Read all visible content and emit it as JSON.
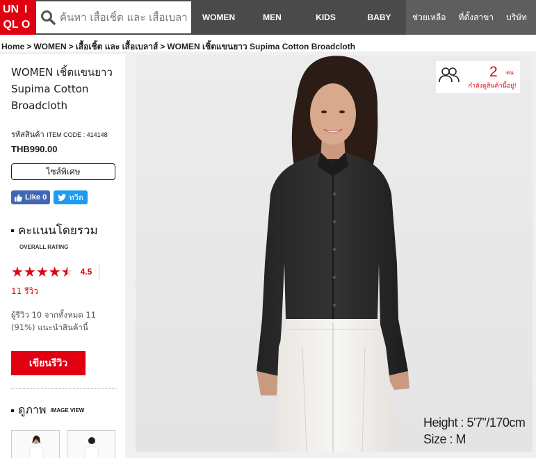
{
  "header": {
    "logo": [
      "UNI",
      "QLO"
    ],
    "search_placeholder": "ค้นหา เสื้อเชิ้ต และ เสื้อเบลาส์",
    "nav": [
      "WOMEN",
      "MEN",
      "KIDS",
      "BABY"
    ],
    "util": [
      "ช่วยเหลือ",
      "ที่ตั้งสาขา",
      "บริษัท"
    ]
  },
  "breadcrumb": [
    "Home",
    "WOMEN",
    "เสื้อเชิ้ต และ เสื้อเบลาส์",
    "WOMEN เชิ้ตแขนยาว Supima Cotton Broadcloth"
  ],
  "breadcrumb_sep": ">",
  "product": {
    "title": "WOMEN เชิ้ตแขนยาว Supima Cotton Broadcloth",
    "code_label": "รหัสสินค้า",
    "code_en": "ITEM CODE : 414148",
    "price": "THB990.00",
    "special_size_label": "ไซส์พิเศษ"
  },
  "social": {
    "like_label": "Like 0",
    "tweet_label": "ทวีต"
  },
  "rating": {
    "heading": "คะแนนโดยรวม",
    "heading_en": "OVERALL RATING",
    "stars_glyphs": "★★★★★",
    "stars_fraction": 0.9,
    "score": "4.5",
    "review_count": "11 รีวิว",
    "summary": "ผู้รีวิว 10 จากทั้งหมด 11 (91%) แนะนำสินค้านี้",
    "write_review": "เขียนรีวิว"
  },
  "image_view": {
    "heading": "ดูภาพ",
    "heading_en": "IMAGE VIEW"
  },
  "live_viewers": {
    "count": "2",
    "unit": "คน",
    "label": "กำลังดูสินค้านี้อยู่!"
  },
  "model_info": {
    "height": "Height : 5'7\"/170cm",
    "size": "Size : M"
  },
  "colors": {
    "brand_red": "#e0000f",
    "header_bg": "#4a4a4a",
    "util_bg": "#5e5e5e",
    "facebook": "#4267b2",
    "twitter": "#1d9bf0"
  }
}
